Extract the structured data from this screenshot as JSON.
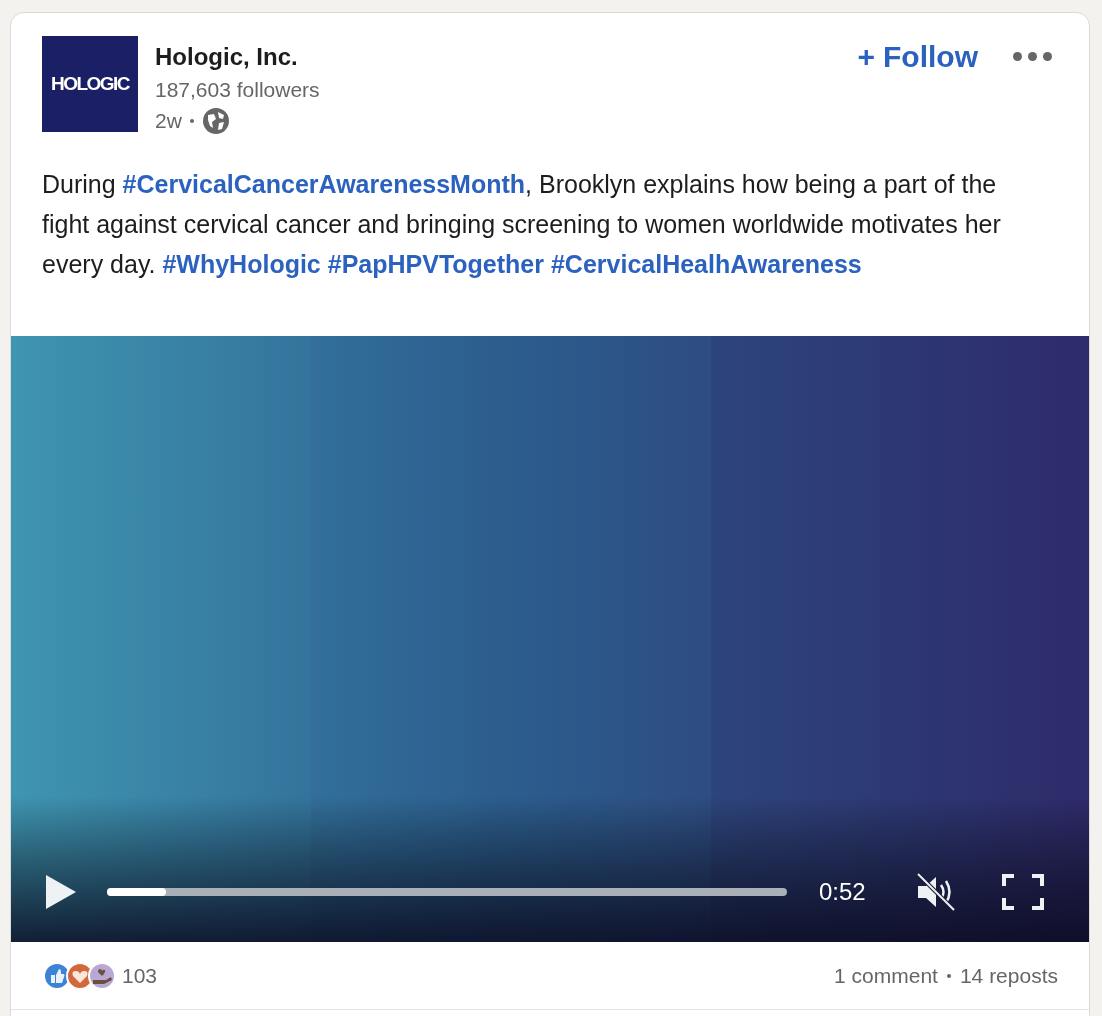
{
  "post": {
    "logo_text": "HOLOGIC",
    "author": "Hologic, Inc.",
    "followers": "187,603 followers",
    "age": "2w",
    "follow": {
      "icon": "+",
      "label": "Follow"
    },
    "body": [
      {
        "kind": "text",
        "text": "During "
      },
      {
        "kind": "hashtag",
        "text": "#CervicalCancerAwarenessMonth"
      },
      {
        "kind": "text",
        "text": ", Brooklyn explains how being a part of the fight against cervical cancer and bringing screening to women worldwide motivates her every day. "
      },
      {
        "kind": "hashtag",
        "text": "#WhyHologic"
      },
      {
        "kind": "hashtag",
        "text": "#PapHPVTogether"
      },
      {
        "kind": "hashtag",
        "text": "#CervicalHealhAwareness"
      }
    ],
    "video": {
      "kind": "picture",
      "progress": {
        "level": 0.087
      },
      "time": "0:52",
      "muted": true
    },
    "reactions_count": "103",
    "comments": "1 comment",
    "reposts": "14 reposts"
  }
}
